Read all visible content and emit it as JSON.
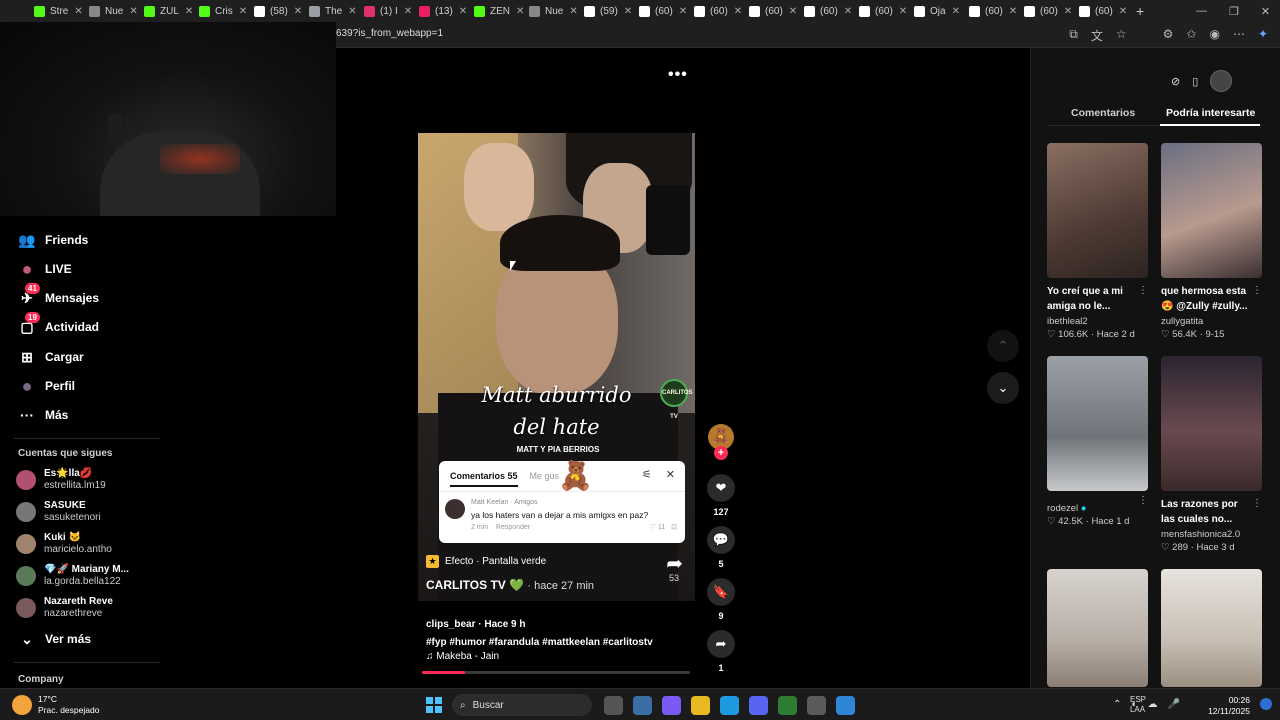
{
  "browser": {
    "tabs": [
      {
        "label": "Stre",
        "color": "#53fc18"
      },
      {
        "label": "Nue",
        "color": "#888888"
      },
      {
        "label": "ZUL",
        "color": "#53fc18"
      },
      {
        "label": "Cris",
        "color": "#53fc18"
      },
      {
        "label": "(58)",
        "color": "#ffffff"
      },
      {
        "label": "The",
        "color": "#9aa0a6"
      },
      {
        "label": "(1) I",
        "color": "#e1306c"
      },
      {
        "label": "(13)",
        "color": "#e91e63"
      },
      {
        "label": "ZEN",
        "color": "#53fc18"
      },
      {
        "label": "Nue",
        "color": "#888888"
      },
      {
        "label": "(59)",
        "color": "#ffffff"
      },
      {
        "label": "(60)",
        "color": "#ffffff"
      },
      {
        "label": "(60)",
        "color": "#ffffff"
      },
      {
        "label": "(60)",
        "color": "#ffffff"
      },
      {
        "label": "(60)",
        "color": "#ffffff"
      },
      {
        "label": "(60)",
        "color": "#ffffff"
      },
      {
        "label": "Oja",
        "color": "#ffffff"
      },
      {
        "label": "(60)",
        "color": "#ffffff"
      },
      {
        "label": "(60)",
        "color": "#ffffff"
      },
      {
        "label": "(60)",
        "color": "#ffffff"
      }
    ],
    "url": "639?is_from_webapp=1"
  },
  "nav": {
    "items": [
      {
        "label": "Friends",
        "icon": "friends-icon",
        "glyph": "👥",
        "badge": ""
      },
      {
        "label": "LIVE",
        "icon": "live-icon",
        "glyph": "●",
        "badge": ""
      },
      {
        "label": "Mensajes",
        "icon": "messages-icon",
        "glyph": "✈",
        "badge": "41"
      },
      {
        "label": "Actividad",
        "icon": "activity-icon",
        "glyph": "▢",
        "badge": "19"
      },
      {
        "label": "Cargar",
        "icon": "upload-icon",
        "glyph": "⊞",
        "badge": ""
      },
      {
        "label": "Perfil",
        "icon": "profile-icon",
        "glyph": "●",
        "badge": ""
      },
      {
        "label": "Más",
        "icon": "more-icon",
        "glyph": "···",
        "badge": ""
      }
    ],
    "following_title": "Cuentas que sigues",
    "following": [
      {
        "name": "Es🌟lla💋",
        "handle": "estrellita.lm19",
        "color": "#b0516f"
      },
      {
        "name": "SASUKE",
        "handle": "sasuketenori",
        "color": "#777777"
      },
      {
        "name": "Kuki 🐱",
        "handle": "maricielo.antho",
        "color": "#a0826d"
      },
      {
        "name": "💎🚀 Mariany M...",
        "handle": "la.gorda.bella122",
        "color": "#5a7a5a"
      },
      {
        "name": "Nazareth Reve",
        "handle": "nazarethreve",
        "color": "#7a5a5a"
      }
    ],
    "see_more": "Ver más",
    "company": "Company"
  },
  "video": {
    "caption_line1": "Matt aburrido",
    "caption_line2": "del hate",
    "subheading": "MATT Y PIA BERRIOS",
    "overlay_logo": "CARLITOS TV",
    "comments_panel": {
      "tab_comments": "Comentarios 55",
      "tab_likes": "Me gus",
      "author": "Matt Keelan · Amigos",
      "text": "ya los haters van a dejar a mis amigxs en paz?",
      "time": "2 min",
      "reply": "Responder",
      "likes": "11"
    },
    "effect": "Efecto · Pantalla verde",
    "author": "CARLITOS TV 💚",
    "posted": "· hace 27 min",
    "inner_share_count": "53",
    "progress": 0.16
  },
  "post": {
    "uploader": "clips_bear · Hace 9 h",
    "hashtags": "#fyp  #humor  #farandula  #mattkeelan  #carlitostv",
    "music": "♫ Makeba - Jain"
  },
  "actions": {
    "likes": "127",
    "comments": "5",
    "saves": "9",
    "shares": "1"
  },
  "right_panel": {
    "tab_comments": "Comentarios",
    "tab_suggested": "Podría interesarte",
    "videos": [
      {
        "title": "Yo creí que a mi amiga no le...",
        "user": "ibethleal2",
        "likes": "106.6K",
        "when": "Hace 2 d",
        "verified": false
      },
      {
        "title": "que hermosa esta 😍 @Zully #zully...",
        "user": "zullygatita",
        "likes": "56.4K",
        "when": "9-15",
        "verified": false
      },
      {
        "title": "",
        "user": "rodezel",
        "likes": "42.5K",
        "when": "Hace 1 d",
        "verified": true
      },
      {
        "title": "Las razones por las cuales no...",
        "user": "mensfashionica2.0",
        "likes": "289",
        "when": "Hace 3 d",
        "verified": false
      },
      {
        "title": "",
        "user": "",
        "likes": "",
        "when": "",
        "verified": false
      },
      {
        "title": "",
        "user": "",
        "likes": "",
        "when": "",
        "verified": false
      }
    ]
  },
  "taskbar": {
    "temp": "17°C",
    "weather": "Prac. despejado",
    "search": "Buscar",
    "lang1": "ESP",
    "lang2": "LAA",
    "time": "00:26",
    "date": "12/11/2025"
  }
}
